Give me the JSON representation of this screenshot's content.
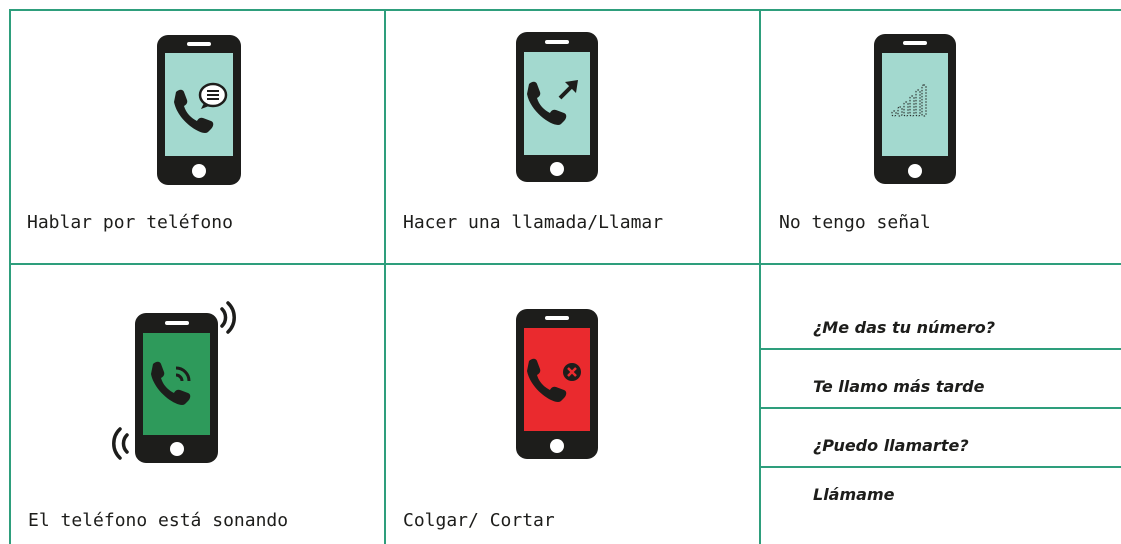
{
  "cells": [
    {
      "caption": "Hablar por teléfono",
      "icon": "phone-chat-bubble-icon",
      "screen_color": "#a3d9cf"
    },
    {
      "caption": "Hacer una llamada/Llamar",
      "icon": "phone-outgoing-call-icon",
      "screen_color": "#a3d9cf"
    },
    {
      "caption": "No tengo señal",
      "icon": "phone-no-signal-icon",
      "screen_color": "#a3d9cf"
    },
    {
      "caption": "El teléfono está sonando",
      "icon": "phone-ringing-icon",
      "screen_color": "#2e9a5b"
    },
    {
      "caption": "Colgar/ Cortar",
      "icon": "phone-hang-up-icon",
      "screen_color": "#ea2a2e"
    }
  ],
  "phrases": [
    "¿Me das tu número?",
    "Te llamo más tarde",
    "¿Puedo llamarte?",
    "Llámame"
  ],
  "colors": {
    "border": "#2e9e7c",
    "phone_body": "#1d1d1b",
    "text": "#1d1d1b"
  }
}
